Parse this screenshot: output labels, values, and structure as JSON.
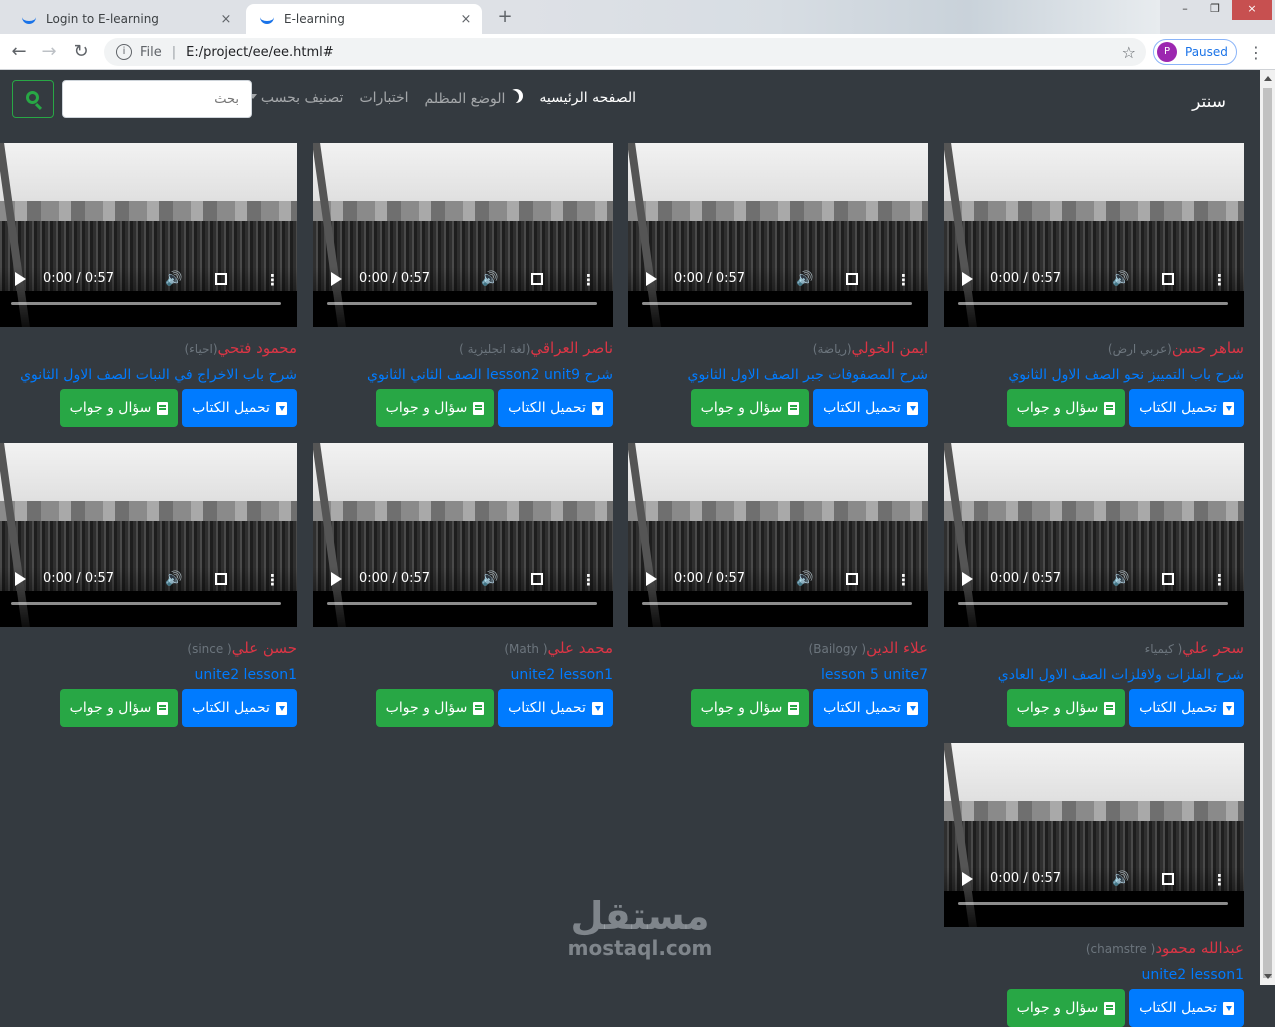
{
  "browser": {
    "tabs": [
      {
        "title": "Login to E-learning",
        "close": "×"
      },
      {
        "title": "E-learning",
        "close": "×"
      }
    ],
    "new_tab": "+",
    "window_controls": [
      "–",
      "❐",
      "×"
    ],
    "nav": {
      "back": "←",
      "forward": "→",
      "reload": "↻"
    },
    "address": {
      "info": "i",
      "scheme": "File",
      "separator": "|",
      "url": "E:/project/ee/ee.html#",
      "star": "☆"
    },
    "profile": {
      "initial": "P",
      "status": "Paused"
    },
    "menu": "⋮"
  },
  "navbar": {
    "brand": "سنتر",
    "home": "الصفحه الرئيسيه",
    "dark_mode": "الوضع المظلم",
    "tests": "اختبارات",
    "sort_by": "تصنيف بحسب",
    "search_placeholder": "بحث"
  },
  "video": {
    "time": "0:00 / 0:57",
    "volume": "🔊",
    "more": "⋮"
  },
  "buttons": {
    "download": "تحميل الكتاب",
    "qa": "سؤال و جواب"
  },
  "cards": [
    {
      "teacher": "ساهر حسن",
      "subject": "(عربي ارض)",
      "lesson": "شرح باب التمييز نحو الصف الاول الثانوي"
    },
    {
      "teacher": "ايمن الخولي",
      "subject": "(رياضة)",
      "lesson": "شرح المصفوفات جبر الصف الاول الثانوي"
    },
    {
      "teacher": "ناصر العراقي",
      "subject": "(لغة انجليزية )",
      "lesson": "شرح lesson2 unit9 الصف الثاني الثانوي"
    },
    {
      "teacher": "محمود فتحي",
      "subject": "(احياء)",
      "lesson": "شرح باب الاخراج في النبات الصف الاول الثانوي"
    },
    {
      "teacher": "سحر علي",
      "subject": "( كيمياء",
      "lesson": "شرح الفلزات ولافلزات الصف الاول العادي"
    },
    {
      "teacher": "علاء الدين",
      "subject": "( Bailogy)",
      "lesson": "lesson 5 unite7"
    },
    {
      "teacher": "محمد علي",
      "subject": "( Math)",
      "lesson": "unite2 lesson1"
    },
    {
      "teacher": "حسن علي",
      "subject": "( since)",
      "lesson": "unite2 lesson1"
    },
    {
      "teacher": "عبدالله محمود",
      "subject": "( chamstre)",
      "lesson": "unite2 lesson1"
    }
  ],
  "watermark": {
    "arabic": "مستقل",
    "latin": "mostaql.com"
  }
}
